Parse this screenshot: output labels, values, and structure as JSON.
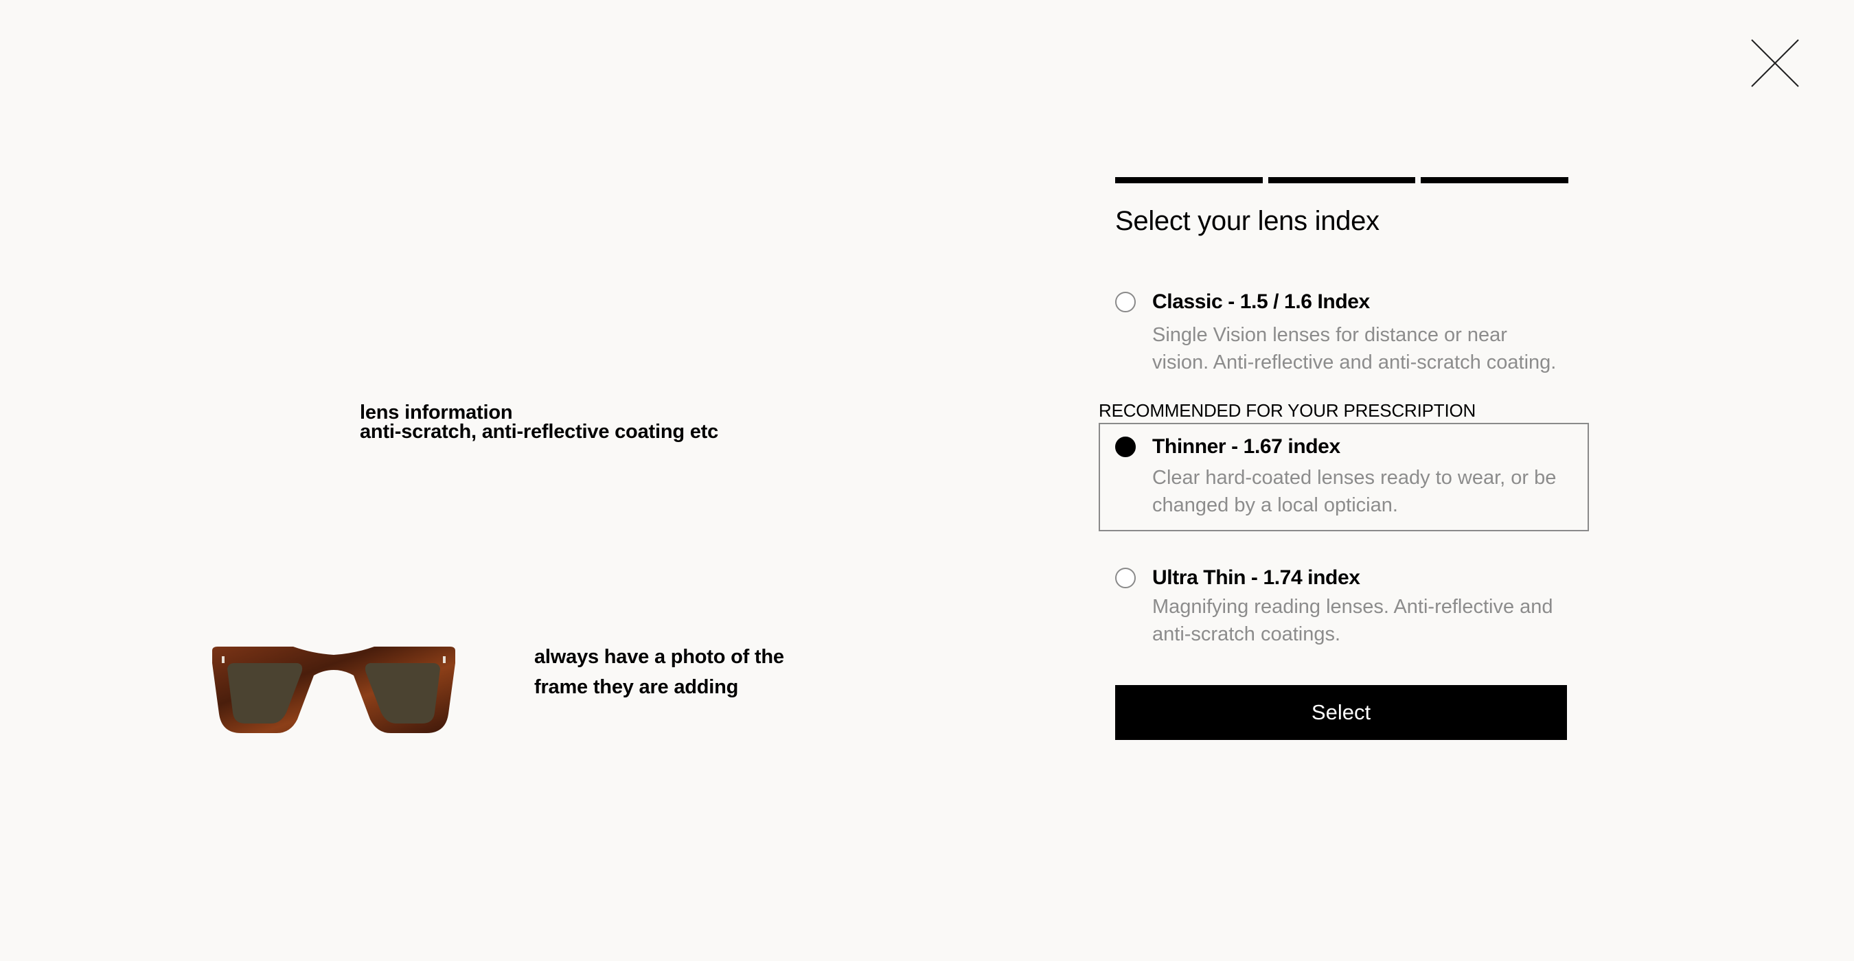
{
  "modal": {
    "close_icon": "close-icon"
  },
  "notes": {
    "lens_info_line1": "lens information",
    "lens_info_line2": "anti-scratch, anti-reflective coating etc",
    "photo_note_line1": "always have a photo of the",
    "photo_note_line2": "frame they are adding"
  },
  "product": {
    "image": "sunglasses-image"
  },
  "progress": {
    "steps_total": 3,
    "steps_complete": 3
  },
  "lens_selector": {
    "title": "Select your lens index",
    "recommended_label": "RECOMMENDED FOR YOUR PRESCRIPTION",
    "options": [
      {
        "name": "Classic - 1.5 / 1.6 Index",
        "description": "Single Vision lenses for distance or near vision. Anti-reflective and anti-scratch coating.",
        "selected": false
      },
      {
        "name": "Thinner - 1.67 index",
        "description": "Clear hard-coated lenses ready to wear, or be changed by a local optician.",
        "selected": true
      },
      {
        "name": "Ultra Thin - 1.74 index",
        "description": "Magnifying reading lenses. Anti-reflective and anti-scratch coatings.",
        "selected": false
      }
    ],
    "select_label": "Select"
  }
}
